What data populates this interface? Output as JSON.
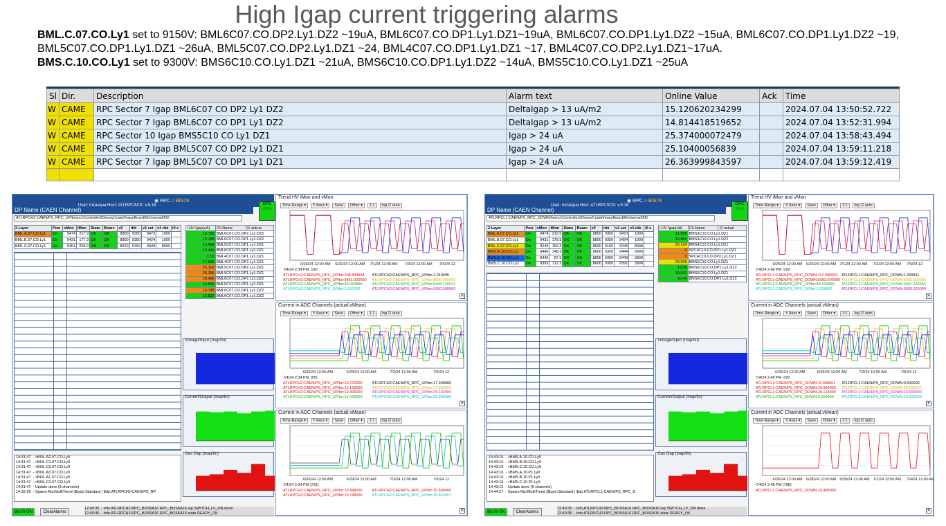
{
  "title": "High Igap current triggering alarms",
  "notes": [
    {
      "bold": "BML.C.07.CO.Ly1",
      "text": " set to 9150V: BML6C07.CO.DP2.Ly1.DZ2 ~19uA, BML6C07.CO.DP1.Ly1.DZ1~19uA, BML6C07.CO.DP1.Ly1.DZ2 ~15uA,  BML6C07.CO.DP1.Ly1.DZ2 ~19, BML5C07.CO.DP1.Ly1.DZ1 ~26uA, BML5C07.CO.DP2.Ly1.DZ1 ~24, BML4C07.CO.DP1.Ly1.DZ1 ~17, BML4C07.CO.DP2.Ly1.DZ1~17uA."
    },
    {
      "bold": "BMS.C.10.CO.Ly1",
      "text": " set to 9300V: BMS6C10.CO.Ly1.DZ1 ~21uA, BMS6C10.CO.DP1.Ly1.DZ2 ~14uA, BMS5C10.CO.Ly1.DZ1 ~25uA"
    }
  ],
  "alarm_table": {
    "headers": [
      "Sl",
      "Dir.",
      "Description",
      "Alarm text",
      "Online Value",
      "Ack",
      "Time"
    ],
    "rows": [
      {
        "sev": "W",
        "dir": "CAME",
        "desc": "RPC Sector 7  Igap BML6C07 CO DP2 Ly1 DZ2",
        "alarm": "DeltaIgap > 13 uA/m2",
        "value": "15.120620234299",
        "ack": "",
        "time": "2024.07.04 13:50:52.722"
      },
      {
        "sev": "W",
        "dir": "CAME",
        "desc": "RPC Sector 7  Igap BML6C07 CO DP1 Ly1 DZ2",
        "alarm": "DeltaIgap > 13 uA/m2",
        "value": "14.814418519652",
        "ack": "",
        "time": "2024.07.04 13:52:31.994"
      },
      {
        "sev": "W",
        "dir": "CAME",
        "desc": "RPC Sector 10  Igap BMS5C10 CO Ly1 DZ1",
        "alarm": "Igap > 24 uA",
        "value": "25.374000072479",
        "ack": "",
        "time": "2024.07.04 13:58:43.494"
      },
      {
        "sev": "W",
        "dir": "CAME",
        "desc": "RPC Sector 7  Igap BML5C07 CO DP2 Ly1 DZ1",
        "alarm": "Igap > 24 uA",
        "value": "25.10400056839",
        "ack": "",
        "time": "2024.07.04 13:59:11.218"
      },
      {
        "sev": "W",
        "dir": "CAME",
        "desc": "RPC Sector 7  Igap BML5C07 CO DP1 Ly1 DZ1",
        "alarm": "Igap > 24 uA",
        "value": "26.363999843597",
        "ack": "",
        "time": "2024.07.04 13:59:12.419"
      }
    ]
  },
  "panels": [
    {
      "radio_rpc": "RPC",
      "radio_bis": "BIS78",
      "user_line": "User: mcasqua  Host: ATLRPCSCS: v.9.18",
      "dp_title": "DP Name (CAEN Channel)",
      "dp_value": "ATLRPCH2:CAEN/PS_RPC_UP/branchController00/easyCrate2/easyBoard06/channel002.",
      "opc": "OPC",
      "channel_headers": [
        "2 Layer",
        "Pow",
        "vMon",
        "iMon",
        "Statu",
        "Boarc",
        "v0",
        "rbk",
        "v1 set",
        "v1 rbk",
        "i0 s"
      ],
      "channels": [
        {
          "name": "BML.A.07.CO.Ly1",
          "pow": "On",
          "vmon": "9474",
          "imon": "217.9",
          "st": "OK",
          "bd": "OK",
          "v0": "8800",
          "rbk": "9350",
          "v1s": "9473",
          "v1r": "1000",
          "color": "#e88b1a"
        },
        {
          "name": "BML.B.07.CO.Ly1",
          "pow": "On",
          "vmon": "9431",
          "imon": "177.3",
          "st": "OK",
          "bd": "OK",
          "v0": "8800",
          "rbk": "9350",
          "v1s": "9424",
          "v1r": "1000",
          "color": "#ffffff"
        },
        {
          "name": "BML.C.07.CO.Ly1",
          "pow": "On",
          "vmon": "9451",
          "imon": "208.9",
          "st": "OK",
          "bd": "OK",
          "v0": "8600",
          "rbk": "9150",
          "v1s": "9448",
          "v1r": "8999",
          "color": "#ffffff"
        }
      ],
      "hv_header": [
        "\\ HV Igap(uA)",
        "Ch.Name",
        "actual"
      ],
      "hv_rows": [
        {
          "v": "10.732",
          "n": "BML6C07.CO.DP2.Ly1.DZ2",
          "c": "#12d412"
        },
        {
          "v": "12.158",
          "n": "BML6C07.CO.DP1.Ly1.DZ2",
          "c": "#12d412"
        },
        {
          "v": "12.498",
          "n": "BML5C07.CO.DP1.Ly1.DZ1",
          "c": "#12d412"
        },
        {
          "v": "12.449",
          "n": "BML6C07.CO.DP1.Ly1.DZ1",
          "c": "#12d412"
        },
        {
          "v": "17.6",
          "n": "BML4C07.CO.DP1.Ly1.DZ1",
          "c": "#12d412"
        },
        {
          "v": "17.806",
          "n": "BML4C07.CO.DP2.Ly1.DZ1",
          "c": "#12d412"
        },
        {
          "v": "25.102",
          "n": "BML5C07.CO.DP2.Ly1.DZ1",
          "c": "#f08a12"
        },
        {
          "v": "26.396",
          "n": "BML5C07.CO.DP1.Ly1.DZ1",
          "c": "#f08a12"
        },
        {
          "v": "18.498",
          "n": "BML6C07.CO.DP2.Ly1.DZ2",
          "c": "#f08a12"
        },
        {
          "v": "15.806",
          "n": "BML6C07.CO.DP1.Ly1.DZ1",
          "c": "#12d412"
        },
        {
          "v": "19.748",
          "n": "BML6C07.CO.DP1.Ly1.DZ2",
          "c": "#f08a12"
        },
        {
          "v": "15.822",
          "n": "BML6C07.CO.DP1.Ly1.DZ2",
          "c": "#12d412"
        }
      ],
      "mini_titles": [
        "Voltage/Input (map/lin)",
        "Current/Output (map/lin)",
        "Gas Gap (map/lin)"
      ],
      "log_lines": [
        "14:31:47  - >BOL.A2.07.CO.Ly0",
        "14:31:47  - >BOL.C1.07.CO.Ly0",
        "14:31:47  - >BOL.C3.07.CO.Ly0",
        "14:31:47  - >BOL.A3.07.CO.Ly0",
        "14:31:47  - >BOL.A1.07.CO.Ly0",
        "14:31:47  - >BOL.C2.07.CO.Ly0",
        "14:31:47  - Update done (3 channels)",
        "14:32:28  - Spawn RpcMultiTrend ($type:Standard | $dp:ATLRPCH2:CAEN/PS_RP"
      ],
      "bis_button": "BIs78  ON",
      "clear_button": "ClearAlarms",
      "status_lines": [
        "12:40:35  - Info ATLRPCH2:RPC_BOS6A16 RPC_BOS6A16.log SWITCH_LV_ON done",
        "12:40:35  - Info ATLRPCH2:RPC_BOS6A16 RPC_BOS6A16.state READY_OK"
      ],
      "trends": [
        {
          "title": "Trend HV iMon and vMon",
          "ts": "7/4/24 2:34 PM  .190",
          "axis": [
            "6/26/24 12:00 AM",
            "6/29/24 12:00 AM",
            "7/1/24 12:00 AM",
            "7/3/24 12:00 AM",
            "7/5/24 12"
          ],
          "legend": [
            {
              "t": "ATLRPCH2:CAEN/PS_RPC_UP/bn:208.899994",
              "c": "#e00000"
            },
            {
              "t": "ATLRPCH2:CAEN/PS_RPC_UP/bn:1.010495",
              "c": "#000000"
            },
            {
              "t": "ATLRPCH2:CAEN/PS_RPC_UP/bn:9451.000000",
              "c": "#e00000"
            },
            {
              "t": "ATLRPCH2:CAEN/PS_RPC_UP/bn:8800.000000",
              "c": "#e0b000"
            },
            {
              "t": "ATLRPCH2:CAEN/PS_RPC_UP/bn:40.419999",
              "c": "#00a000"
            },
            {
              "t": "ATLRPCH2:CAEN/PS_RPC_UP/bn:9448.130041",
              "c": "#00c000"
            },
            {
              "t": "ATLRPCH2:CAEN/PS_RPC_UP/bn:1.997002",
              "c": "#00c0c0"
            },
            {
              "t": "ATLRPCH2:CAEN/PS_RPC_UP/bn:9350.000000",
              "c": "#c000c0"
            }
          ]
        },
        {
          "title": "Current in ADC Channels (actual.vMean)",
          "ts": "7/4/24 2:34 PM  .830",
          "axis": [
            "6/26/24 12:00 AM",
            "6/29/24 12:00 AM",
            "7/2/24 12:00 AM",
            "7/5/24 12"
          ],
          "legend": [
            {
              "t": "ATLRPCH2:CAEN/PS_RPC_UP/bn:10.732000",
              "c": "#e00000"
            },
            {
              "t": "ATLRPCH2:CAEN/PS_RPC_UP/bn:17.900000",
              "c": "#000000"
            },
            {
              "t": "ATLRPCH2:CAEN/PS_RPC_UP/bn:12.158000",
              "c": "#e00000"
            },
            {
              "t": "ATLRPCH2:CAEN/PS_RPC_UP/bn:17.806000",
              "c": "#e0b000"
            },
            {
              "t": "ATLRPCH2:CAEN/PS_RPC_UP/bn:12.406000",
              "c": "#e00000"
            },
            {
              "t": "ATLRPCH2:CAEN/PS_RPC_UP/bn:25.102000",
              "c": "#e000e0"
            },
            {
              "t": "ATLRPCH2:CAEN/PS_RPC_UP/bn:12.449000",
              "c": "#00c000"
            },
            {
              "t": "ATLRPCH2:CAEN/PS_RPC_UP/bn:26.396000",
              "c": "#00c0c0"
            }
          ]
        },
        {
          "title": "Current in ADC Channels (actual.vMean)",
          "ts": "7/4/24 2:34 PM  (731)",
          "axis": [
            "6/26/24 12:00 AM",
            "6/29/24 12:00 AM",
            "7/2/24 12:00 AM",
            "7/5/24 12"
          ],
          "legend": [
            {
              "t": "ATLRPCH2:CAEN/PS_RPC_UP/bn:19.498000",
              "c": "#e00000"
            },
            {
              "t": "ATLRPCH2:CAEN/PS_RPC_UP/bn:15.806000",
              "c": "#e00000"
            },
            {
              "t": "ATLRPCH2:CAEN/PS_RPC_UP/bn:19.748000",
              "c": "#e00000"
            },
            {
              "t": "ATLRPCH2:CAEN/PS_RPC_UP/bn:15.822001",
              "c": "#00c0c0"
            }
          ]
        }
      ]
    },
    {
      "radio_rpc": "RPC",
      "radio_bis": "BIS78",
      "user_line": "User: mcasqua  Host: ATLRPCSCS: v.9.18",
      "dp_title": "DP Name (CAEN Channel)",
      "dp_value": "ATLRPCL1:CAEN/PS_RPC_DOWN/branchController00/easyCrate0/easyBoard06/channel005.",
      "opc": "OPC",
      "channel_headers": [
        "2 Layer",
        "Pow",
        "vMon",
        "iMon",
        "Statu",
        "Boarc",
        "v0",
        "rbk",
        "v1 set",
        "v1 rbk",
        "i0 s"
      ],
      "channels": [
        {
          "name": "BML.A.07.CO.Ly1",
          "pow": "On",
          "vmon": "9474",
          "imon": "219.5",
          "st": "OK",
          "bd": "OK",
          "v0": "8800",
          "rbk": "9350",
          "v1s": "9473",
          "v1r": "1000",
          "color": "#e88b1a"
        },
        {
          "name": "BML.B.07.CO.Ly1",
          "pow": "On",
          "vmon": "9431",
          "imon": "178.5",
          "st": "OK",
          "bd": "OK",
          "v0": "8800",
          "rbk": "9350",
          "v1s": "9424",
          "v1r": "1000",
          "color": "#ffffff"
        },
        {
          "name": "BML.C.07.CO.Ly1",
          "pow": "On",
          "vmon": "9249",
          "imon": "159.3",
          "st": "OK",
          "bd": "OK",
          "v0": "8600",
          "rbk": "9150",
          "v1s": "9246",
          "v1r": "8999",
          "color": "#f0e000"
        },
        {
          "name": "BMS.A.10.CO.Ly1",
          "pow": "On",
          "vmon": "9446",
          "imon": "148.3",
          "st": "OK",
          "bd": "OK",
          "v0": "8800",
          "rbk": "9350",
          "v1s": "9444",
          "v1r": "3999",
          "color": "#e88b1a"
        },
        {
          "name": "BMS.B.10.CO.Ly1",
          "pow": "On",
          "vmon": "9445",
          "imon": "87.5",
          "st": "OK",
          "bd": "OK",
          "v0": "8800",
          "rbk": "9350",
          "v1s": "9443",
          "v1r": "3999",
          "color": "#1a6ae8"
        },
        {
          "name": "BMS.C.10.CO.Ly1",
          "pow": "On",
          "vmon": "9393",
          "imon": "112.3",
          "st": "OK",
          "bd": "OK",
          "v0": "8600",
          "rbk": "9300",
          "v1s": "9391",
          "v1r": "3999",
          "color": "#ffffff"
        }
      ],
      "hv_header": [
        "\\ HV Igap(uA)",
        "Ch.Name",
        "actual"
      ],
      "hv_rows": [
        {
          "v": "11.598",
          "n": "BMS3C10.CO.Ly1.DZ1",
          "c": "#12d412"
        },
        {
          "v": "10.954",
          "n": "BMS3C10.CO.Ly1.DZ2",
          "c": "#12d412"
        },
        {
          "v": "20.124",
          "n": "BMS4C10.CO.Ly1.DZ1",
          "c": "#f0e000"
        },
        {
          "v": "0",
          "n": "SPC4C10.CO.DP1.Ly1.DZ1",
          "c": "#f08a12"
        },
        {
          "v": "0",
          "n": "SPC4C10.CO.DP2.Ly1.DZ1",
          "c": "#f08a12"
        },
        {
          "v": "23.598",
          "n": "BMS5C10.CO.Ly1.DZ1",
          "c": "#f0e000"
        },
        {
          "v": "13.59",
          "n": "BMS6C10.CO.DP1.Ly1.DZ2",
          "c": "#12d412"
        },
        {
          "v": "19.912",
          "n": "BMS6C10.CO.Ly1.DZ1",
          "c": "#12d412"
        },
        {
          "v": "10.49",
          "n": "BMS6C10.CO.DP2.Ly1.DZ2",
          "c": "#12d412"
        }
      ],
      "mini_titles": [
        "Voltage/Input (map/lin)",
        "Current/Output (map/lin)",
        "Gas Gap (map/lin)"
      ],
      "log_lines": [
        "14:43:16  - >BMS.A.10.CO.Ly0",
        "14:43:16  - >BMS.B.10.CO.Ly0",
        "14:43:16  - >BMS.C.10.CO.Ly0",
        "14:43:16  - >BMS.A.10.P1.Ly0",
        "14:43:16  - >BMS.B.10.P1.Ly0",
        "14:43:16  - >BMS.C.10.P1.Ly0",
        "14:43:16  - Update done (6 channels)",
        "14:44:27  - Spawn RpcMultiTrend ($type:Standard | $dp:ATLRPCL1:CAEN/PS_RPC_D"
      ],
      "bis_button": "BIs78  OK",
      "clear_button": "ClearAlarms",
      "status_lines": [
        "12:40:35  - Info ATLRPCH2:RPC_BOS6A16 RPC_BOS6A16.log SWITCH_LV_ON done",
        "12:40:35  - Info ATLRPCH2:RPC_BOS6A16 RPC_BOS6A16.state READY_OK"
      ],
      "trends": [
        {
          "title": "Trend HV iMon and vMon",
          "ts": "7/4/24 2:48 PM  .092",
          "axis": [
            "6/26/24 12:00 AM",
            "6/29/24 12:00 AM",
            "7/1/24 12:00 AM",
            "7/3/24 12:00 AM",
            "7/5/24 12"
          ],
          "legend": [
            {
              "t": "ATLRPCL1:CAEN/PS_RPC_DOWN:112.300003",
              "c": "#e00000"
            },
            {
              "t": "ATLRPCL1:CAEN/PS_RPC_DOWN:1.009811",
              "c": "#000000"
            },
            {
              "t": "ATLRPCL1:CAEN/PS_RPC_DOWN:9393.000000",
              "c": "#e00000"
            },
            {
              "t": "ATLRPCL1:CAEN/PS_RPC_DOWN:8600.000000",
              "c": "#e0b000"
            },
            {
              "t": "ATLRPCL1:CAEN/PS_RPC_UP/bn:40.419999",
              "c": "#00a000"
            },
            {
              "t": "ATLRPCL1:CAEN/PS_RPC_DOWN:9391.243655",
              "c": "#00c000"
            },
            {
              "t": "ATLRPCL1:CAEN/PS_RPC_UP/bn:1.008600",
              "c": "#00c0c0"
            },
            {
              "t": "ATLRPCL1:CAEN/PS_RPC_DOWN:9300.000000",
              "c": "#c000c0"
            }
          ]
        },
        {
          "title": "Current in ADC Channels (actual.vMean)",
          "ts": "7/4/24 2:48 PM  .092",
          "axis": [
            "6/26/24 12:00 AM",
            "6/29/24 12:00 AM",
            "7/2/24 12:00 AM",
            "7/5/24 12"
          ],
          "legend": [
            {
              "t": "ATLRPCL1:CAEN/PS_RPC_DOWN:11.598001",
              "c": "#e00000"
            },
            {
              "t": "ATLRPCL1:CAEN/PS_RPC_DOWN:0.000000",
              "c": "#000000"
            },
            {
              "t": "ATLRPCL1:CAEN/PS_RPC_DOWN:10.954000",
              "c": "#e00000"
            },
            {
              "t": "ATLRPCL1:CAEN/PS_RPC_DOWN:23.598001",
              "c": "#e0b000"
            },
            {
              "t": "ATLRPCL1:CAEN/PS_RPC_DOWN:20.123999",
              "c": "#e00000"
            },
            {
              "t": "ATLRPCL1:CAEN/PS_RPC_DOWN:13.590000",
              "c": "#e000e0"
            },
            {
              "t": "ATLRPCL1:CAEN/PS_RPC_DOWN:0.000000",
              "c": "#00c000"
            },
            {
              "t": "ATLRPCL1:CAEN/PS_RPC_DOWN:19.912000",
              "c": "#00c0c0"
            }
          ]
        },
        {
          "title": "Current in ADC Channels (actual.vMean)",
          "ts": "7/4/24 2:48 PM  (798)",
          "axis": [
            "6/26/24 12:00 AM",
            "6/28/24 12:00 AM",
            "6/30/24 12:00 AM",
            "7/2/24 12:00 AM",
            "7/4/24 12:00 AM"
          ],
          "legend": [
            {
              "t": "ATLRPCL1:CAEN/PS_RPC_DOWN:10.490000",
              "c": "#e00000"
            }
          ]
        }
      ]
    }
  ]
}
